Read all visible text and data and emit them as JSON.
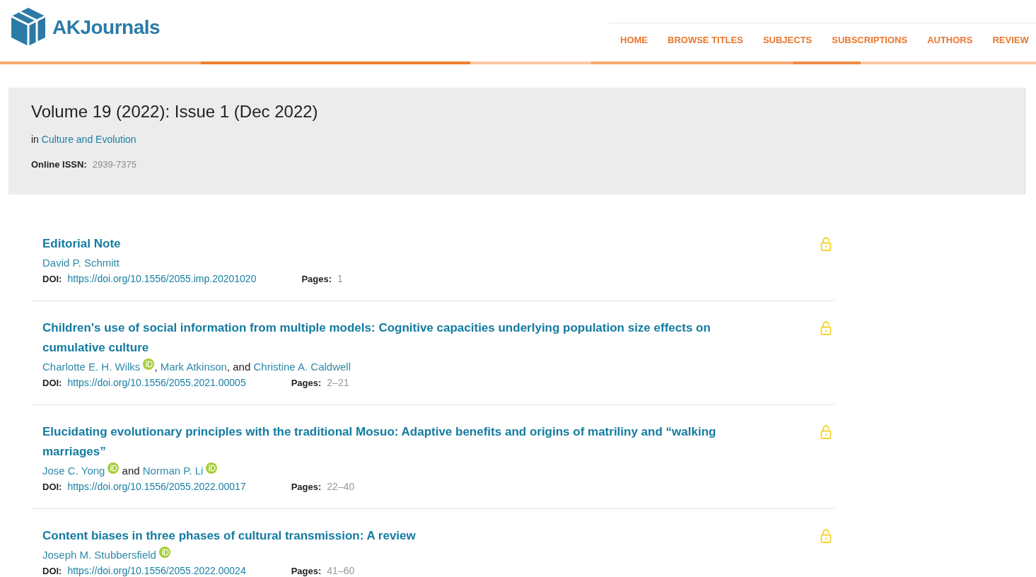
{
  "header": {
    "logo": {
      "text": "AKJournals"
    },
    "nav": [
      {
        "label": "HOME"
      },
      {
        "label": "BROWSE TITLES"
      },
      {
        "label": "SUBJECTS"
      },
      {
        "label": "SUBSCRIPTIONS"
      },
      {
        "label": "AUTHORS"
      },
      {
        "label": "REVIEW"
      }
    ]
  },
  "issue": {
    "title": "Volume 19 (2022): Issue 1 (Dec 2022)",
    "journal_prefix": "in",
    "journal": "Culture and Evolution",
    "issn_label": "Online ISSN:",
    "issn": "2939-7375"
  },
  "articles": [
    {
      "title": "Editorial Note",
      "authors": [
        {
          "name": "David P. Schmitt",
          "orcid": false
        }
      ],
      "doi_label": "DOI:",
      "doi": "https://doi.org/10.1556/2055.imp.20201020",
      "pages_label": "Pages:",
      "pages": "1"
    },
    {
      "title": "Children's use of social information from multiple models: Cognitive capacities underlying population size effects on cumulative culture",
      "authors": [
        {
          "name": "Charlotte E. H. Wilks",
          "orcid": true
        },
        {
          "before": ", ",
          "name": "Mark Atkinson",
          "orcid": false
        },
        {
          "before": ", and ",
          "name": "Christine A. Caldwell",
          "orcid": false
        }
      ],
      "doi_label": "DOI:",
      "doi": "https://doi.org/10.1556/2055.2021.00005",
      "pages_label": "Pages:",
      "pages": "2–21"
    },
    {
      "title": "Elucidating evolutionary principles with the traditional Mosuo: Adaptive benefits and origins of matriliny and “walking marriages”",
      "authors": [
        {
          "name": "Jose C. Yong",
          "orcid": true
        },
        {
          "before": " and ",
          "name": "Norman P. Li",
          "orcid": true
        }
      ],
      "doi_label": "DOI:",
      "doi": "https://doi.org/10.1556/2055.2022.00017",
      "pages_label": "Pages:",
      "pages": "22–40"
    },
    {
      "title": "Content biases in three phases of cultural transmission: A review",
      "authors": [
        {
          "name": "Joseph M. Stubbersfield",
          "orcid": true
        }
      ],
      "doi_label": "DOI:",
      "doi": "https://doi.org/10.1556/2055.2022.00024",
      "pages_label": "Pages:",
      "pages": "41–60"
    }
  ]
}
